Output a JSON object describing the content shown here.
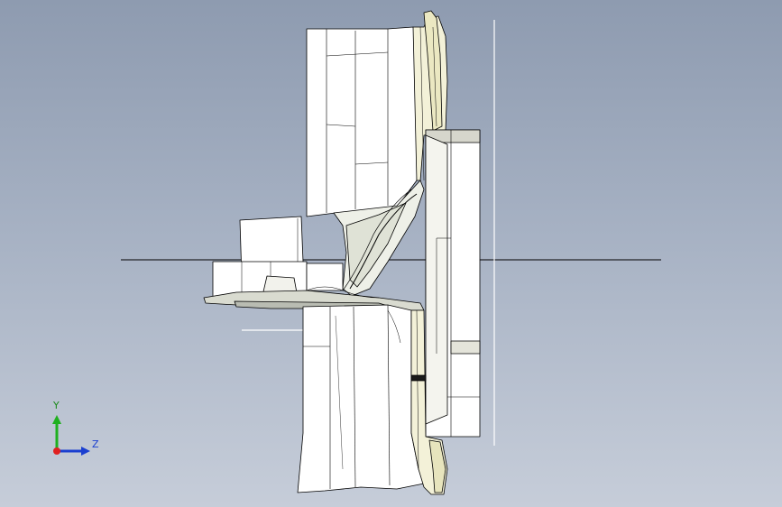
{
  "viewport": {
    "background_top": "#8e9bb0",
    "background_bottom": "#c6cdd9",
    "model_fill": "#ffffff",
    "model_shade": "#efeed8",
    "model_shadow": "#c9cab8",
    "edge_color": "#000000"
  },
  "triad": {
    "y_label": "Y",
    "z_label": "Z",
    "y_color": "#1fb01f",
    "z_color": "#1a3fd0",
    "origin_color": "#e02020"
  }
}
